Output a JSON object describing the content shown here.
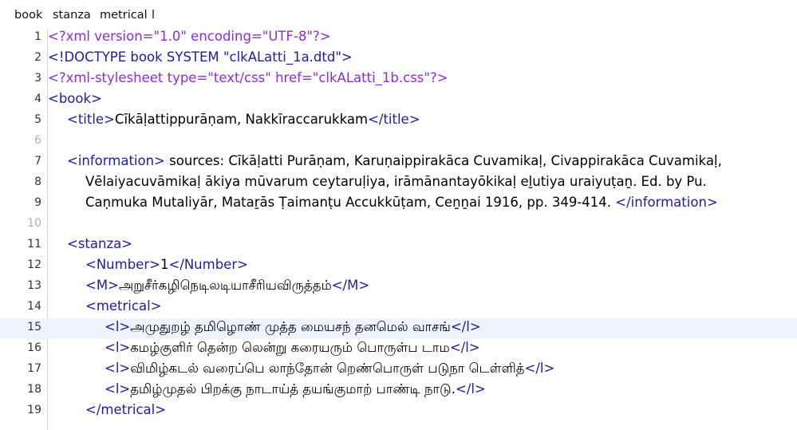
{
  "breadcrumb": [
    "book",
    "stanza",
    "metrical",
    "l"
  ],
  "current_line": 15,
  "lines": [
    {
      "n": "1",
      "parts": [
        {
          "c": "pi",
          "t": "<?xml version=\"1.0\" encoding=\"UTF-8\"?>"
        }
      ]
    },
    {
      "n": "2",
      "parts": [
        {
          "c": "tag",
          "t": "<!DOCTYPE book SYSTEM \"clkALatti_1a.dtd\">"
        }
      ]
    },
    {
      "n": "3",
      "parts": [
        {
          "c": "pi",
          "t": "<?xml-stylesheet type=\"text/css\" href=\"clkALatti_1b.css\"?>"
        }
      ]
    },
    {
      "n": "4",
      "parts": [
        {
          "c": "tag",
          "t": "<book>"
        }
      ]
    },
    {
      "n": "5",
      "parts": [
        {
          "c": "tag",
          "t": "<title>"
        },
        {
          "c": "txt",
          "t": "Cīkāḷattippurāṇam, Nakkīraccarukkam"
        },
        {
          "c": "tag",
          "t": "</title>"
        }
      ]
    },
    {
      "n": "6",
      "parts": []
    },
    {
      "n": "7",
      "parts": [
        {
          "c": "tag",
          "t": "<information>"
        },
        {
          "c": "txt",
          "t": " sources: Cīkāḷatti Purāṇam, Karuṇaippirakāca Cuvamikaḷ, Civappirakāca Cuvamikaḷ,"
        }
      ]
    },
    {
      "n": "8",
      "parts": [
        {
          "c": "txt",
          "t": "Vēlaiyacuvāmikaḷ ākiya mūvarum ceytaruḷiya, irāmānantayōkikaḷ eḻutiya uraiyuṭaṉ. Ed. by Pu."
        }
      ]
    },
    {
      "n": "9",
      "parts": [
        {
          "c": "txt",
          "t": "Caṇmuka Mutaliyār, Mataṟās Ṭaimanṭu Accukkūṭam, Ceṉṉai 1916, pp. 349-414. "
        },
        {
          "c": "tag",
          "t": "</information>"
        }
      ]
    },
    {
      "n": "10",
      "parts": []
    },
    {
      "n": "11",
      "parts": [
        {
          "c": "tag",
          "t": "<stanza>"
        }
      ]
    },
    {
      "n": "12",
      "parts": [
        {
          "c": "tag",
          "t": "<Number>"
        },
        {
          "c": "txt",
          "t": "1"
        },
        {
          "c": "tag",
          "t": "</Number>"
        }
      ]
    },
    {
      "n": "13",
      "parts": [
        {
          "c": "tag",
          "t": "<M>"
        },
        {
          "c": "txt",
          "t": "அறுசீர்கழிநெடிலடியாசீரியவிருத்தம்"
        },
        {
          "c": "tag",
          "t": "</M>"
        }
      ]
    },
    {
      "n": "14",
      "parts": [
        {
          "c": "tag",
          "t": "<metrical>"
        }
      ]
    },
    {
      "n": "15",
      "parts": [
        {
          "c": "tag",
          "t": "<l>"
        },
        {
          "c": "txt",
          "t": "அமுதுறழ் தமிழொண் முத்த மையசந் தனமெல் வாசங்"
        },
        {
          "c": "tag",
          "t": "</l>"
        }
      ]
    },
    {
      "n": "16",
      "parts": [
        {
          "c": "tag",
          "t": "<l>"
        },
        {
          "c": "txt",
          "t": "கமழ்குளிர் தென்ற லென்று கரையரும் பொருள்ப டாம"
        },
        {
          "c": "tag",
          "t": "</l>"
        }
      ]
    },
    {
      "n": "17",
      "parts": [
        {
          "c": "tag",
          "t": "<l>"
        },
        {
          "c": "txt",
          "t": "விமிழ்கடல் வரைப்பெ லாந்தோன் றெண்பொருள் படுநா டெள்ளித்"
        },
        {
          "c": "tag",
          "t": "</l>"
        }
      ]
    },
    {
      "n": "18",
      "parts": [
        {
          "c": "tag",
          "t": "<l>"
        },
        {
          "c": "txt",
          "t": "தமிழ்முதல் பிறக்கு நாடாய்த் தயங்குமாற் பாண்டி நாடு."
        },
        {
          "c": "tag",
          "t": "</l>"
        }
      ]
    },
    {
      "n": "19",
      "parts": [
        {
          "c": "tag",
          "t": "</metrical>"
        }
      ]
    }
  ]
}
